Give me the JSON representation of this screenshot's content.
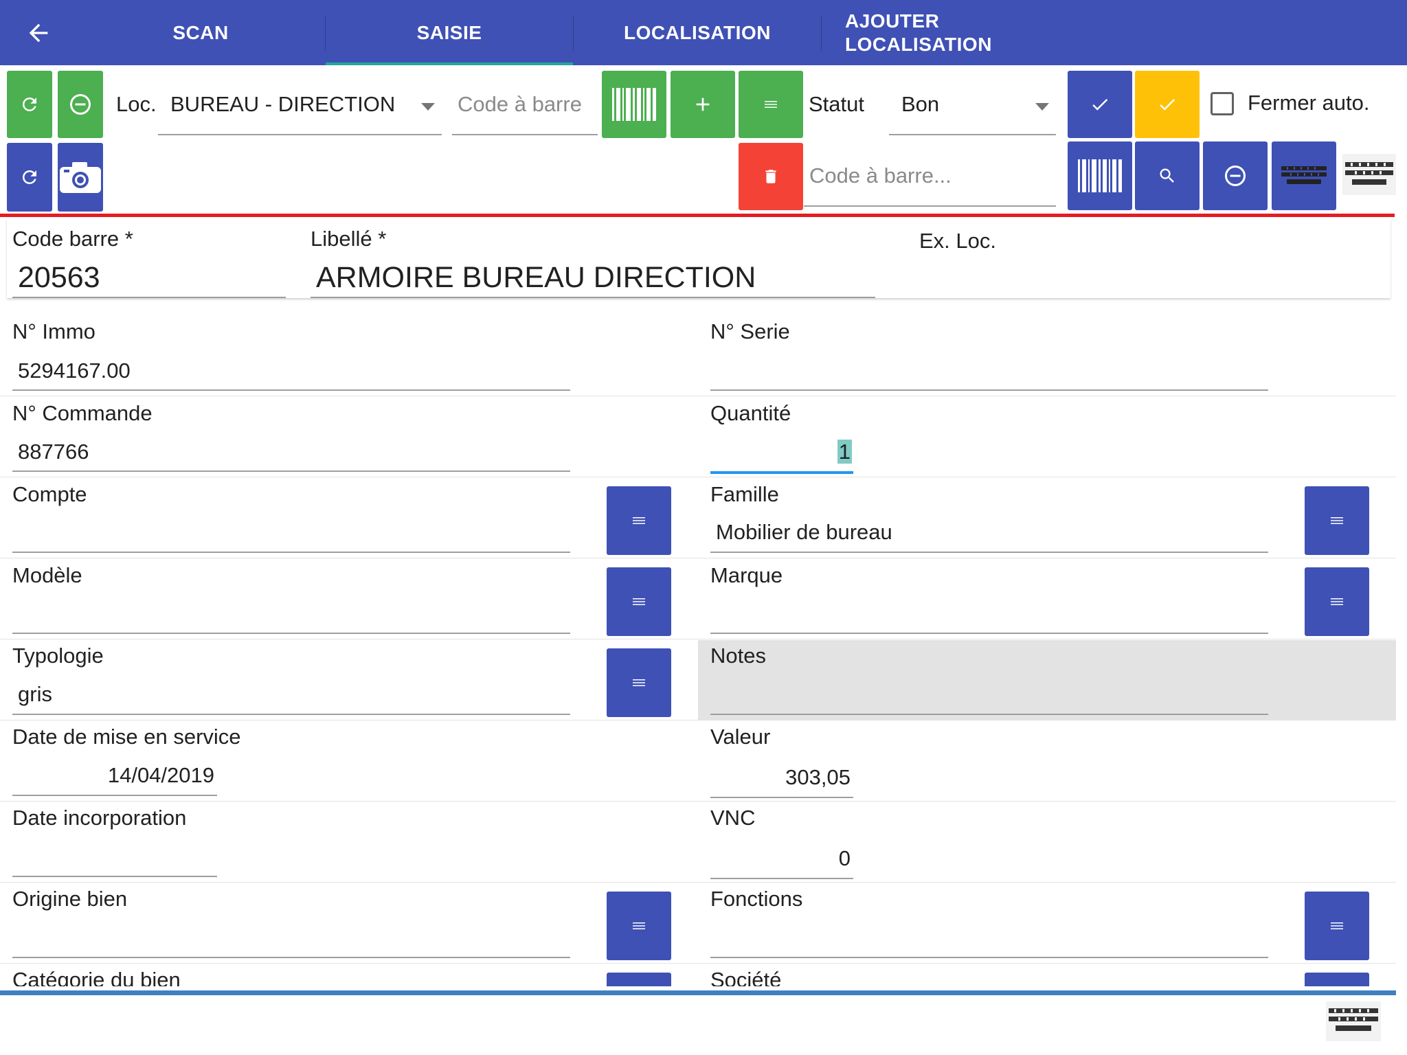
{
  "tabs": [
    {
      "label": "SCAN"
    },
    {
      "label": "SAISIE"
    },
    {
      "label": "LOCALISATION"
    },
    {
      "label_line1": "AJOUTER",
      "label_line2": "LOCALISATION"
    }
  ],
  "active_tab": "SAISIE",
  "toolbar": {
    "loc_label": "Loc.",
    "loc_value": "BUREAU - DIRECTION",
    "barcode_placeholder": "Code à barre",
    "statut_label": "Statut",
    "statut_value": "Bon",
    "fermer_auto_label": "Fermer auto.",
    "fermer_auto_checked": false,
    "search_barcode_placeholder": "Code à barre..."
  },
  "header": {
    "code_barre_label": "Code barre *",
    "code_barre_value": "20563",
    "libelle_label": "Libellé *",
    "libelle_value": "ARMOIRE BUREAU DIRECTION",
    "ex_loc_label": "Ex. Loc."
  },
  "fields": {
    "immo": {
      "label": "N° Immo",
      "value": "5294167.00"
    },
    "serie": {
      "label": "N° Serie",
      "value": ""
    },
    "commande": {
      "label": "N° Commande",
      "value": "887766"
    },
    "quantite": {
      "label": "Quantité",
      "value": "1"
    },
    "compte": {
      "label": "Compte",
      "value": ""
    },
    "famille": {
      "label": "Famille",
      "value": "Mobilier de bureau"
    },
    "modele": {
      "label": "Modèle",
      "value": ""
    },
    "marque": {
      "label": "Marque",
      "value": ""
    },
    "typologie": {
      "label": "Typologie",
      "value": "gris"
    },
    "notes": {
      "label": "Notes",
      "value": ""
    },
    "date_service": {
      "label": "Date de mise en service",
      "value": "14/04/2019"
    },
    "valeur": {
      "label": "Valeur",
      "value": "303,05"
    },
    "date_incorporation": {
      "label": "Date incorporation",
      "value": ""
    },
    "vnc": {
      "label": "VNC",
      "value": "0"
    },
    "origine": {
      "label": "Origine bien",
      "value": ""
    },
    "fonctions": {
      "label": "Fonctions",
      "value": ""
    },
    "categorie": {
      "label": "Catégorie du bien",
      "value": ""
    },
    "societe": {
      "label": "Société",
      "value": ""
    }
  },
  "colors": {
    "primary": "#3f51b5",
    "green": "#4caf50",
    "amber": "#ffc107",
    "red": "#f44336",
    "accent": "#26a69a"
  },
  "icons": [
    "arrow-back-icon",
    "refresh-icon",
    "remove-circle-icon",
    "barcode-icon",
    "plus-icon",
    "menu-icon",
    "check-icon",
    "delete-icon",
    "camera-icon",
    "search-icon",
    "keyboard-icon"
  ]
}
